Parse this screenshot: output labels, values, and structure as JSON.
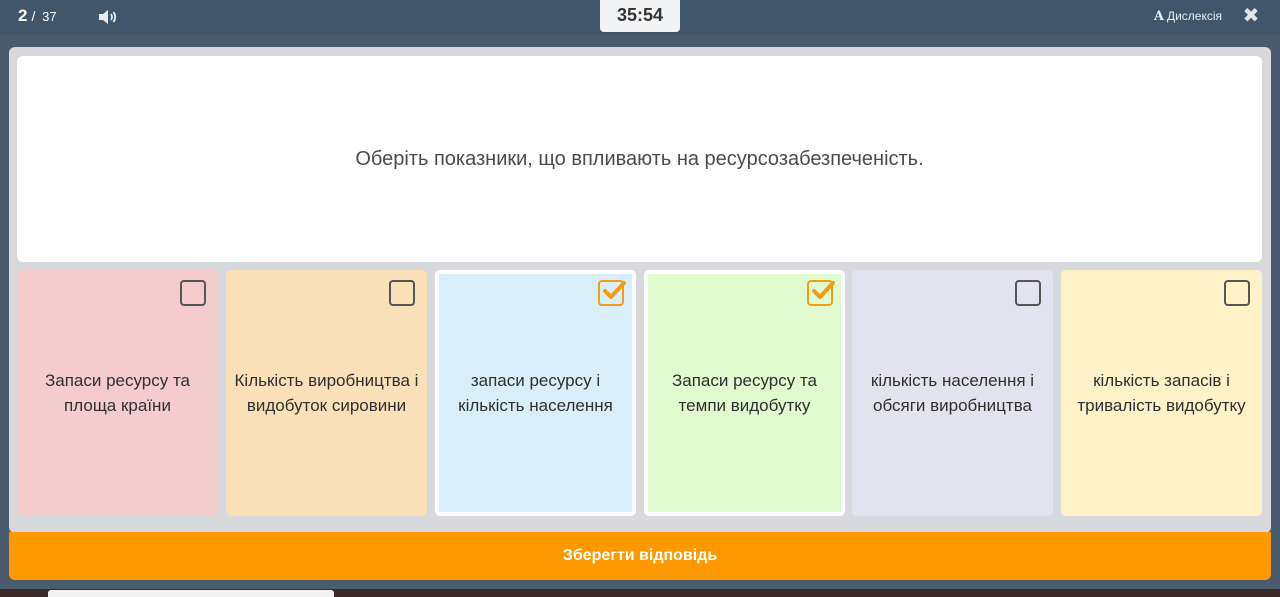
{
  "topbar": {
    "current": "2",
    "separator": "/",
    "total": "37",
    "speaker_icon": "speaker-icon",
    "timer": "35:54",
    "dyslexia_letter": "A",
    "dyslexia_label": "Дислексія",
    "close_icon": "close-icon"
  },
  "question": {
    "text": "Оберіть показники, що впливають на ресурсозабезпеченість."
  },
  "options": [
    {
      "label_line1": "Запаси ресурсу та",
      "label_line2": "площа країни",
      "color": "#f5cccd",
      "selected": false
    },
    {
      "label_line1": "Кількість виробництва і",
      "label_line2": "видобуток сировини",
      "color": "#fae0b8",
      "selected": false
    },
    {
      "label_line1": "запаси ресурсу і",
      "label_line2": "кількість населення",
      "color": "#d8eff9",
      "selected": true
    },
    {
      "label_line1": "Запаси ресурсу та",
      "label_line2": "темпи видобутку",
      "color": "#e0fbd0",
      "selected": true
    },
    {
      "label_line1": "кількість населення і",
      "label_line2": "обсяги виробництва",
      "color": "#e3e3ef",
      "selected": false
    },
    {
      "label_line1": "кількість запасів і",
      "label_line2": "тривалість видобутку",
      "color": "#fff1c8",
      "selected": false
    }
  ],
  "save_button": {
    "label": "Зберегти відповідь",
    "color": "#ff9900"
  },
  "colors": {
    "topbar": "#42566b",
    "accent": "#f39c12"
  }
}
